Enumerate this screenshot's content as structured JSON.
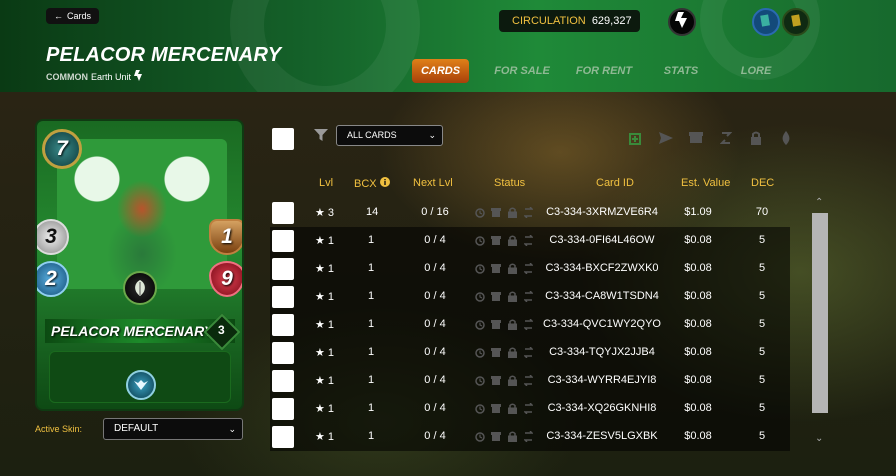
{
  "header": {
    "back_label": "Cards",
    "title": "PELACOR MERCENARY",
    "rarity": "COMMON",
    "type": "Earth Unit",
    "circulation_label": "CIRCULATION",
    "circulation_value": "629,327",
    "tabs": [
      {
        "label": "CARDS",
        "active": true
      },
      {
        "label": "FOR SALE",
        "active": false
      },
      {
        "label": "FOR RENT",
        "active": false
      },
      {
        "label": "STATS",
        "active": false
      },
      {
        "label": "LORE",
        "active": false
      }
    ]
  },
  "card": {
    "name": "PELACOR MERCENARY",
    "mana": "7",
    "melee": "3",
    "armor": "1",
    "speed": "2",
    "health": "9",
    "level": "3",
    "element_icon": "earth-leaf-icon",
    "ability_icon": "wings-ability-icon"
  },
  "skin": {
    "label": "Active Skin:",
    "value": "DEFAULT"
  },
  "filter": {
    "value": "ALL CARDS"
  },
  "table": {
    "headers": [
      "Lvl",
      "BCX",
      "Next Lvl",
      "Status",
      "Card ID",
      "Est. Value",
      "DEC"
    ],
    "rows": [
      {
        "lvl": "★ 3",
        "bcx": "14",
        "next": "0 / 16",
        "id": "C3-334-3XRMZVE6R4",
        "value": "$1.09",
        "dec": "70"
      },
      {
        "lvl": "★ 1",
        "bcx": "1",
        "next": "0 / 4",
        "id": "C3-334-0FI64L46OW",
        "value": "$0.08",
        "dec": "5"
      },
      {
        "lvl": "★ 1",
        "bcx": "1",
        "next": "0 / 4",
        "id": "C3-334-BXCF2ZWXK0",
        "value": "$0.08",
        "dec": "5"
      },
      {
        "lvl": "★ 1",
        "bcx": "1",
        "next": "0 / 4",
        "id": "C3-334-CA8W1TSDN4",
        "value": "$0.08",
        "dec": "5"
      },
      {
        "lvl": "★ 1",
        "bcx": "1",
        "next": "0 / 4",
        "id": "C3-334-QVC1WY2QYO",
        "value": "$0.08",
        "dec": "5"
      },
      {
        "lvl": "★ 1",
        "bcx": "1",
        "next": "0 / 4",
        "id": "C3-334-TQYJX2JJB4",
        "value": "$0.08",
        "dec": "5"
      },
      {
        "lvl": "★ 1",
        "bcx": "1",
        "next": "0 / 4",
        "id": "C3-334-WYRR4EJYI8",
        "value": "$0.08",
        "dec": "5"
      },
      {
        "lvl": "★ 1",
        "bcx": "1",
        "next": "0 / 4",
        "id": "C3-334-XQ26GKNHI8",
        "value": "$0.08",
        "dec": "5"
      },
      {
        "lvl": "★ 1",
        "bcx": "1",
        "next": "0 / 4",
        "id": "C3-334-ZESV5LGXBK",
        "value": "$0.08",
        "dec": "5"
      }
    ]
  },
  "colors": {
    "accent": "#f0c040",
    "active_tab": "#e08018",
    "header_green": "#1f8a38"
  }
}
